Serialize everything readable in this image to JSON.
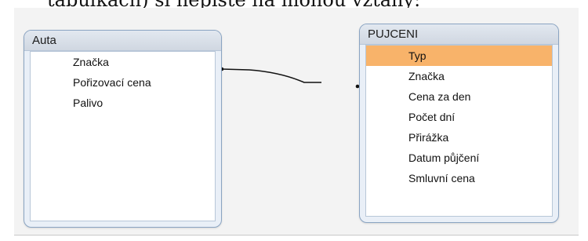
{
  "top_text": "tabulkách) si nepište na mohou vztahy:",
  "tables": {
    "auta": {
      "title": "Auta",
      "fields": [
        "Značka",
        "Pořizovací cena",
        "Palivo"
      ]
    },
    "pujceni": {
      "title": "PUJCENI",
      "fields": [
        "Typ",
        "Značka",
        "Cena za den",
        "Počet dní",
        "Přirážka",
        "Datum půjčení",
        "Smluvní cena"
      ],
      "selected_field": "Typ"
    }
  },
  "relationship": {
    "from": "Auta.Značka",
    "to": "PUJCENI.Značka"
  },
  "colors": {
    "selected_row": "#f8b36a",
    "table_border": "#8aa4c2",
    "canvas_background": "#f3f3f3"
  }
}
